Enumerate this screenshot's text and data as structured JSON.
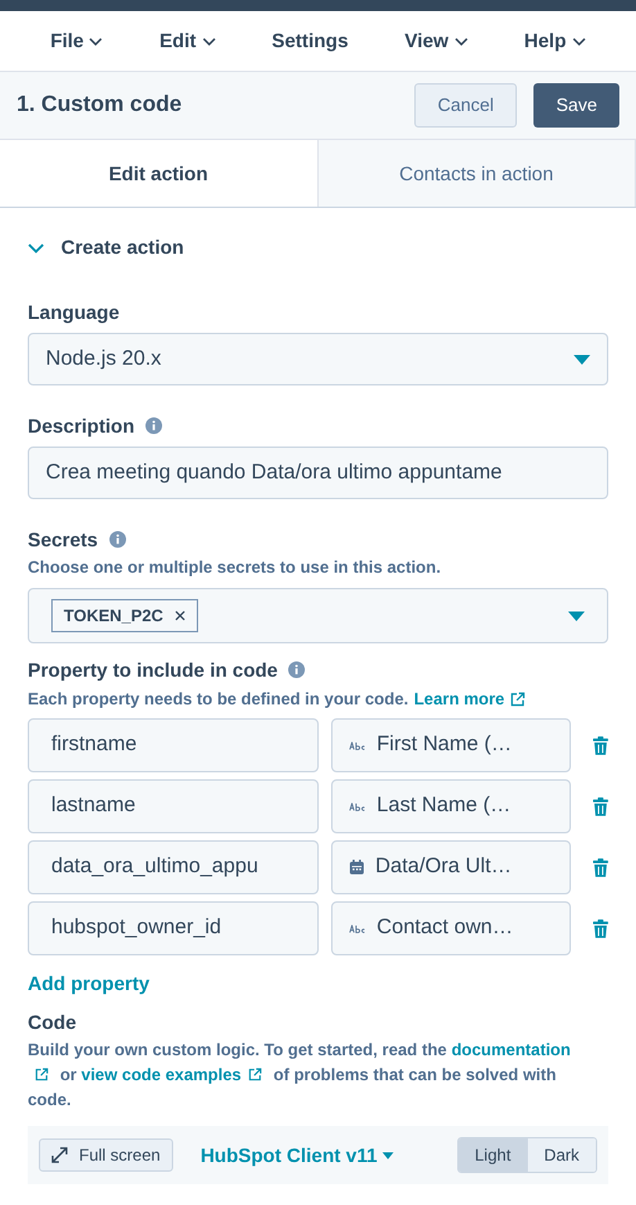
{
  "menu": [
    {
      "label": "File",
      "dropdown": true
    },
    {
      "label": "Edit",
      "dropdown": true
    },
    {
      "label": "Settings",
      "dropdown": false
    },
    {
      "label": "View",
      "dropdown": true
    },
    {
      "label": "Help",
      "dropdown": true
    }
  ],
  "header": {
    "title": "1. Custom code",
    "buttons": [
      {
        "label": "Cancel",
        "kind": "secondary"
      },
      {
        "label": "Save",
        "kind": "primary"
      }
    ]
  },
  "tabs": [
    {
      "label": "Edit action",
      "selected": true
    },
    {
      "label": "Contacts in action",
      "selected": false
    }
  ],
  "section": {
    "title": "Create action",
    "expanded": true
  },
  "language": {
    "label": "Language",
    "value": "Node.js 20.x"
  },
  "description": {
    "label": "Description",
    "value": "Crea meeting quando Data/ora ultimo appuntame"
  },
  "secrets": {
    "label": "Secrets",
    "help": "Choose one or multiple secrets to use in this action.",
    "tags": [
      "TOKEN_P2C"
    ]
  },
  "properties": {
    "label": "Property to include in code",
    "help": "Each property needs to be defined in your code.",
    "link": "Learn more",
    "rows": [
      {
        "name": "firstname",
        "property": "First Name (…",
        "kind": "text"
      },
      {
        "name": "lastname",
        "property": "Last Name (…",
        "kind": "text"
      },
      {
        "name": "data_ora_ultimo_appu",
        "property": "Data/Ora Ult…",
        "kind": "date"
      },
      {
        "name": "hubspot_owner_id",
        "property": "Contact own…",
        "kind": "text"
      }
    ],
    "add": "Add property"
  },
  "code": {
    "label": "Code",
    "help": [
      {
        "kind": "text",
        "text": "Build your own custom logic. To get started, read the "
      },
      {
        "kind": "link",
        "text": "documentation"
      },
      {
        "kind": "text",
        "text": " or "
      },
      {
        "kind": "link",
        "text": "view code examples"
      },
      {
        "kind": "text",
        "text": " of problems that can be solved with code."
      }
    ]
  },
  "toolbar": {
    "fullscreen": "Full screen",
    "client": "HubSpot Client v11",
    "themes": [
      {
        "label": "Light",
        "selected": true
      },
      {
        "label": "Dark",
        "selected": false
      }
    ]
  }
}
